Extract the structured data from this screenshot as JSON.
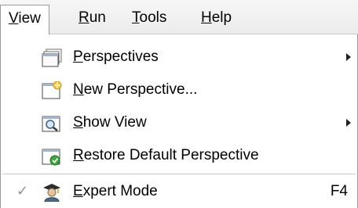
{
  "menubar": {
    "items": [
      {
        "label_u": "V",
        "label_rest": "iew"
      },
      {
        "label_u": "R",
        "label_rest": "un"
      },
      {
        "label_u": "T",
        "label_rest": "ools"
      },
      {
        "label_u": "H",
        "label_rest": "elp"
      }
    ]
  },
  "menu": {
    "items": [
      {
        "label_u": "P",
        "label_rest": "erspectives",
        "icon": "perspectives-icon",
        "submenu": true
      },
      {
        "label_u": "N",
        "label_rest": "ew Perspective...",
        "icon": "new-perspective-icon"
      },
      {
        "label_u": "S",
        "label_rest": "how View",
        "icon": "show-view-icon",
        "submenu": true
      },
      {
        "label_u": "R",
        "label_rest": "estore Default Perspective",
        "icon": "restore-perspective-icon"
      },
      {
        "label_u": "E",
        "label_rest": "xpert Mode",
        "icon": "expert-mode-icon",
        "checked": true,
        "check_mark": "✓",
        "accelerator": "F4"
      }
    ]
  }
}
